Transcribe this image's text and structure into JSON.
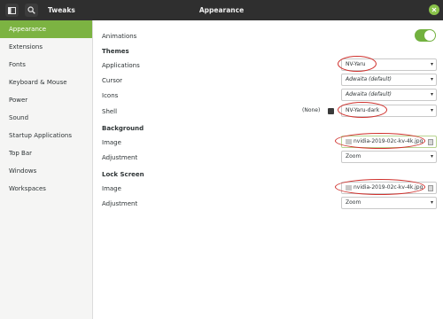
{
  "header": {
    "app_title": "Tweaks",
    "window_title": "Appearance",
    "grid_icon": "panel-icon",
    "search_icon": "search-icon",
    "close_icon": "close-icon",
    "accent": "#7cb342"
  },
  "sidebar": {
    "items": [
      {
        "label": "Appearance",
        "active": true
      },
      {
        "label": "Extensions"
      },
      {
        "label": "Fonts"
      },
      {
        "label": "Keyboard & Mouse"
      },
      {
        "label": "Power"
      },
      {
        "label": "Sound"
      },
      {
        "label": "Startup Applications"
      },
      {
        "label": "Top Bar"
      },
      {
        "label": "Windows"
      },
      {
        "label": "Workspaces"
      }
    ]
  },
  "main": {
    "animations": {
      "label": "Animations",
      "enabled": true
    },
    "themes": {
      "heading": "Themes",
      "applications": {
        "label": "Applications",
        "value": "NV-Yaru"
      },
      "cursor": {
        "label": "Cursor",
        "value": "Adwaita (default)"
      },
      "icons": {
        "label": "Icons",
        "value": "Adwaita (default)"
      },
      "shell": {
        "label": "Shell",
        "none_label": "(None)",
        "value": "NV-Yaru-dark"
      }
    },
    "background": {
      "heading": "Background",
      "image": {
        "label": "Image",
        "value": "nvidia-2019-02c-kv-4k.jpg"
      },
      "adjustment": {
        "label": "Adjustment",
        "value": "Zoom"
      }
    },
    "lock_screen": {
      "heading": "Lock Screen",
      "image": {
        "label": "Image",
        "value": "nvidia-2019-02c-kv-4k.jpg"
      },
      "adjustment": {
        "label": "Adjustment",
        "value": "Zoom"
      }
    },
    "dropdown_arrow": "▾"
  }
}
